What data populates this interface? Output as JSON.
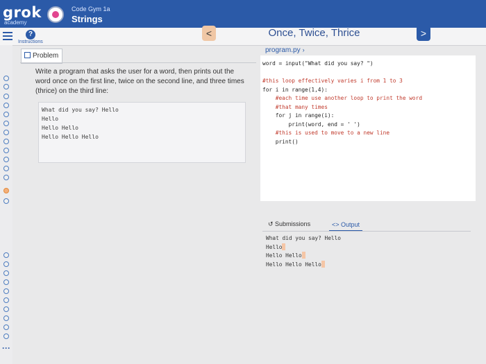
{
  "brand": {
    "name": "grok",
    "sub": "academy"
  },
  "course": {
    "title": "Code Gym 1a",
    "subtitle": "Strings"
  },
  "nav": {
    "instructions_label": "Instructions",
    "help": "?",
    "prev": "<",
    "next": ">",
    "step_title": "Once, Twice, Thrice"
  },
  "problem": {
    "tab_label": "Problem",
    "description": "Write a program that asks the user for a word, then prints out the word once on the first line, twice on the second line, and three times (thrice) on the third line:",
    "example_lines": [
      "What did you say? Hello",
      "Hello",
      "Hello Hello",
      "Hello Hello Hello"
    ]
  },
  "editor": {
    "file_name": "program.py",
    "code_lines": [
      "word = input(\"What did you say? \")",
      "",
      "#this loop effectively varies i from 1 to 3",
      "for i in range(1,4):",
      "    #each time use another loop to print the word",
      "    #that many times",
      "    for j in range(i):",
      "        print(word, end = ' ')",
      "    #this is used to move to a new line",
      "    print()"
    ]
  },
  "output_panel": {
    "submissions_label": "Submissions",
    "output_label": "Output",
    "lines": [
      "What did you say? Hello",
      "Hello",
      "Hello Hello",
      "Hello Hello Hello"
    ]
  },
  "colors": {
    "header": "#2b5aa8",
    "accent": "#e38b3c"
  }
}
